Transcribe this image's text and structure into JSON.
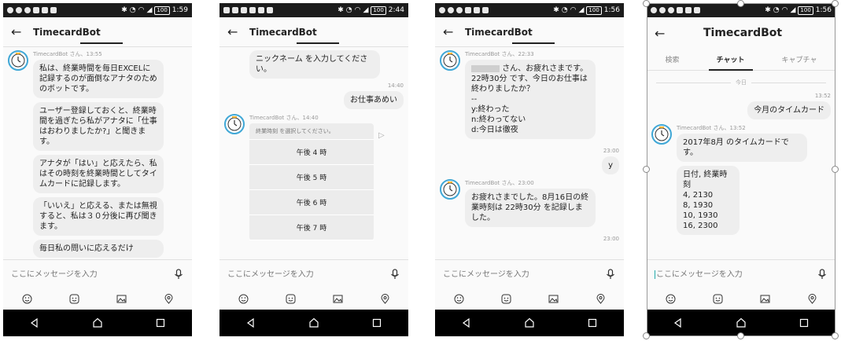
{
  "status_bars": [
    {
      "battery": "100",
      "time": "1:59"
    },
    {
      "battery": "100",
      "time": "2:44"
    },
    {
      "battery": "100",
      "time": "1:56"
    },
    {
      "battery": "100",
      "time": "1:56"
    }
  ],
  "app": {
    "title": "TimecardBot"
  },
  "input": {
    "placeholder": "ここにメッセージを入力"
  },
  "screen1": {
    "meta": "TimecardBot さん、13:55",
    "msg1": "私は、終業時間を毎日EXCELに記録するのが面倒なアナタのためのボットです。",
    "msg2": "ユーザー登録しておくと、終業時間を過ぎたら私がアナタに「仕事はおわりましたか?」と聞きます。",
    "msg3": "アナタが「はい」と応えたら、私はその時刻を終業時間としてタイムカードに記録します。",
    "msg4": "「いいえ」と応える、または無視すると、私は３０分後に再び聞きます。",
    "msg5": "毎日私の問いに応えるだけ"
  },
  "screen2": {
    "msg_top": "ニックネーム を入力してください。",
    "user_time": "14:40",
    "user_msg": "お仕事あめい",
    "meta": "TimecardBot さん、14:40",
    "picker_head": "終業時刻 を選択してください。",
    "options": [
      "午後 4 時",
      "午後 5 時",
      "午後 6 時",
      "午後 7 時"
    ]
  },
  "screen3": {
    "meta1": "TimecardBot さん、22:33",
    "msg1_a": "さん、お疲れさまです。22時30分 です、今日のお仕事は終わりましたか？",
    "msg1_b": "--\ny:終わった\nn:終わってない\nd:今日は徹夜",
    "user_time": "23:00",
    "user_msg": "y",
    "meta2": "TimecardBot さん、23:00",
    "msg2": "お疲れさまでした。8月16日の終業時刻は 22時30分 を記録しました。",
    "time_bottom": "23:00"
  },
  "screen4": {
    "tabs": [
      "検索",
      "チャット",
      "キャプチャ"
    ],
    "date_divider": "今日",
    "user_time": "13:52",
    "user_msg": "今月のタイムカード",
    "meta": "TimecardBot さん、13:52",
    "msg1": "2017年8月 のタイムカードです。",
    "msg2": "日付, 終業時刻\n4, 2130\n8, 1930\n10, 1930\n16, 2300"
  },
  "colors": {
    "avatar_ring": "#3fa7d6",
    "bubble": "#eeeeee",
    "status_bg": "#1c1c1c"
  },
  "icons": [
    "back-arrow-icon",
    "mic-icon",
    "emoji-icon",
    "sticker-icon",
    "image-icon",
    "location-icon",
    "nav-back-icon",
    "nav-home-icon",
    "nav-recents-icon",
    "clock-avatar-icon",
    "share-icon"
  ]
}
